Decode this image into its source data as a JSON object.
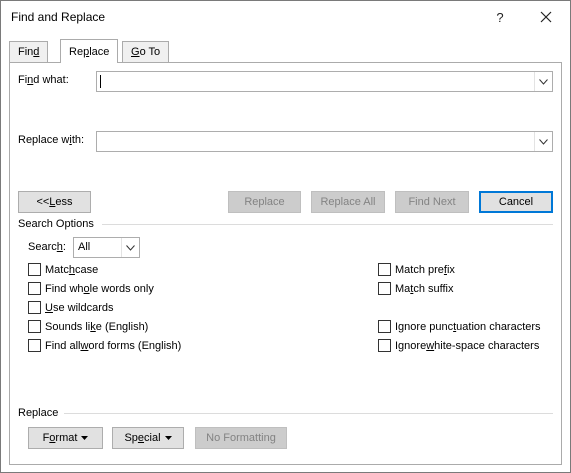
{
  "window": {
    "title": "Find and Replace",
    "help": "?"
  },
  "tabs": [
    {
      "pre": "Fin",
      "ul": "d",
      "post": ""
    },
    {
      "pre": "Re",
      "ul": "p",
      "post": "lace"
    },
    {
      "pre": "",
      "ul": "G",
      "post": "o To"
    }
  ],
  "find": {
    "pre": "Fi",
    "ul": "n",
    "post": "d what:",
    "value": ""
  },
  "replace": {
    "pre": "Replace w",
    "ul": "i",
    "post": "th:",
    "value": ""
  },
  "buttons": {
    "less": {
      "pre": "<< ",
      "ul": "L",
      "post": "ess"
    },
    "replace": "Replace",
    "replace_all": "Replace All",
    "find_next": "Find Next",
    "cancel": "Cancel"
  },
  "search_options": {
    "heading": "Search Options",
    "search_label": {
      "pre": "Searc",
      "ul": "h",
      "post": ":"
    },
    "search_value": "All"
  },
  "options_left": [
    {
      "pre": "Matc",
      "ul": "h",
      "post": " case",
      "checked": false
    },
    {
      "pre": "Find wh",
      "ul": "o",
      "post": "le words only",
      "checked": false
    },
    {
      "pre": "",
      "ul": "U",
      "post": "se wildcards",
      "checked": false
    },
    {
      "pre": "Sounds li",
      "ul": "k",
      "post": "e (English)",
      "checked": false
    },
    {
      "pre": "Find all ",
      "ul": "w",
      "post": "ord forms (English)",
      "checked": false
    }
  ],
  "options_right": [
    {
      "pre": "Match pre",
      "ul": "f",
      "post": "ix",
      "checked": false
    },
    {
      "pre": "Ma",
      "ul": "t",
      "post": "ch suffix",
      "checked": false
    },
    {
      "pre": "Ignore punc",
      "ul": "t",
      "post": "uation characters",
      "checked": false
    },
    {
      "pre": "Ignore ",
      "ul": "w",
      "post": "hite-space characters",
      "checked": false
    }
  ],
  "replace_section": {
    "heading": "Replace",
    "format": {
      "pre": "F",
      "ul": "o",
      "post": "rmat"
    },
    "special": {
      "pre": "Sp",
      "ul": "e",
      "post": "cial"
    },
    "no_formatting": "No Formatting"
  }
}
